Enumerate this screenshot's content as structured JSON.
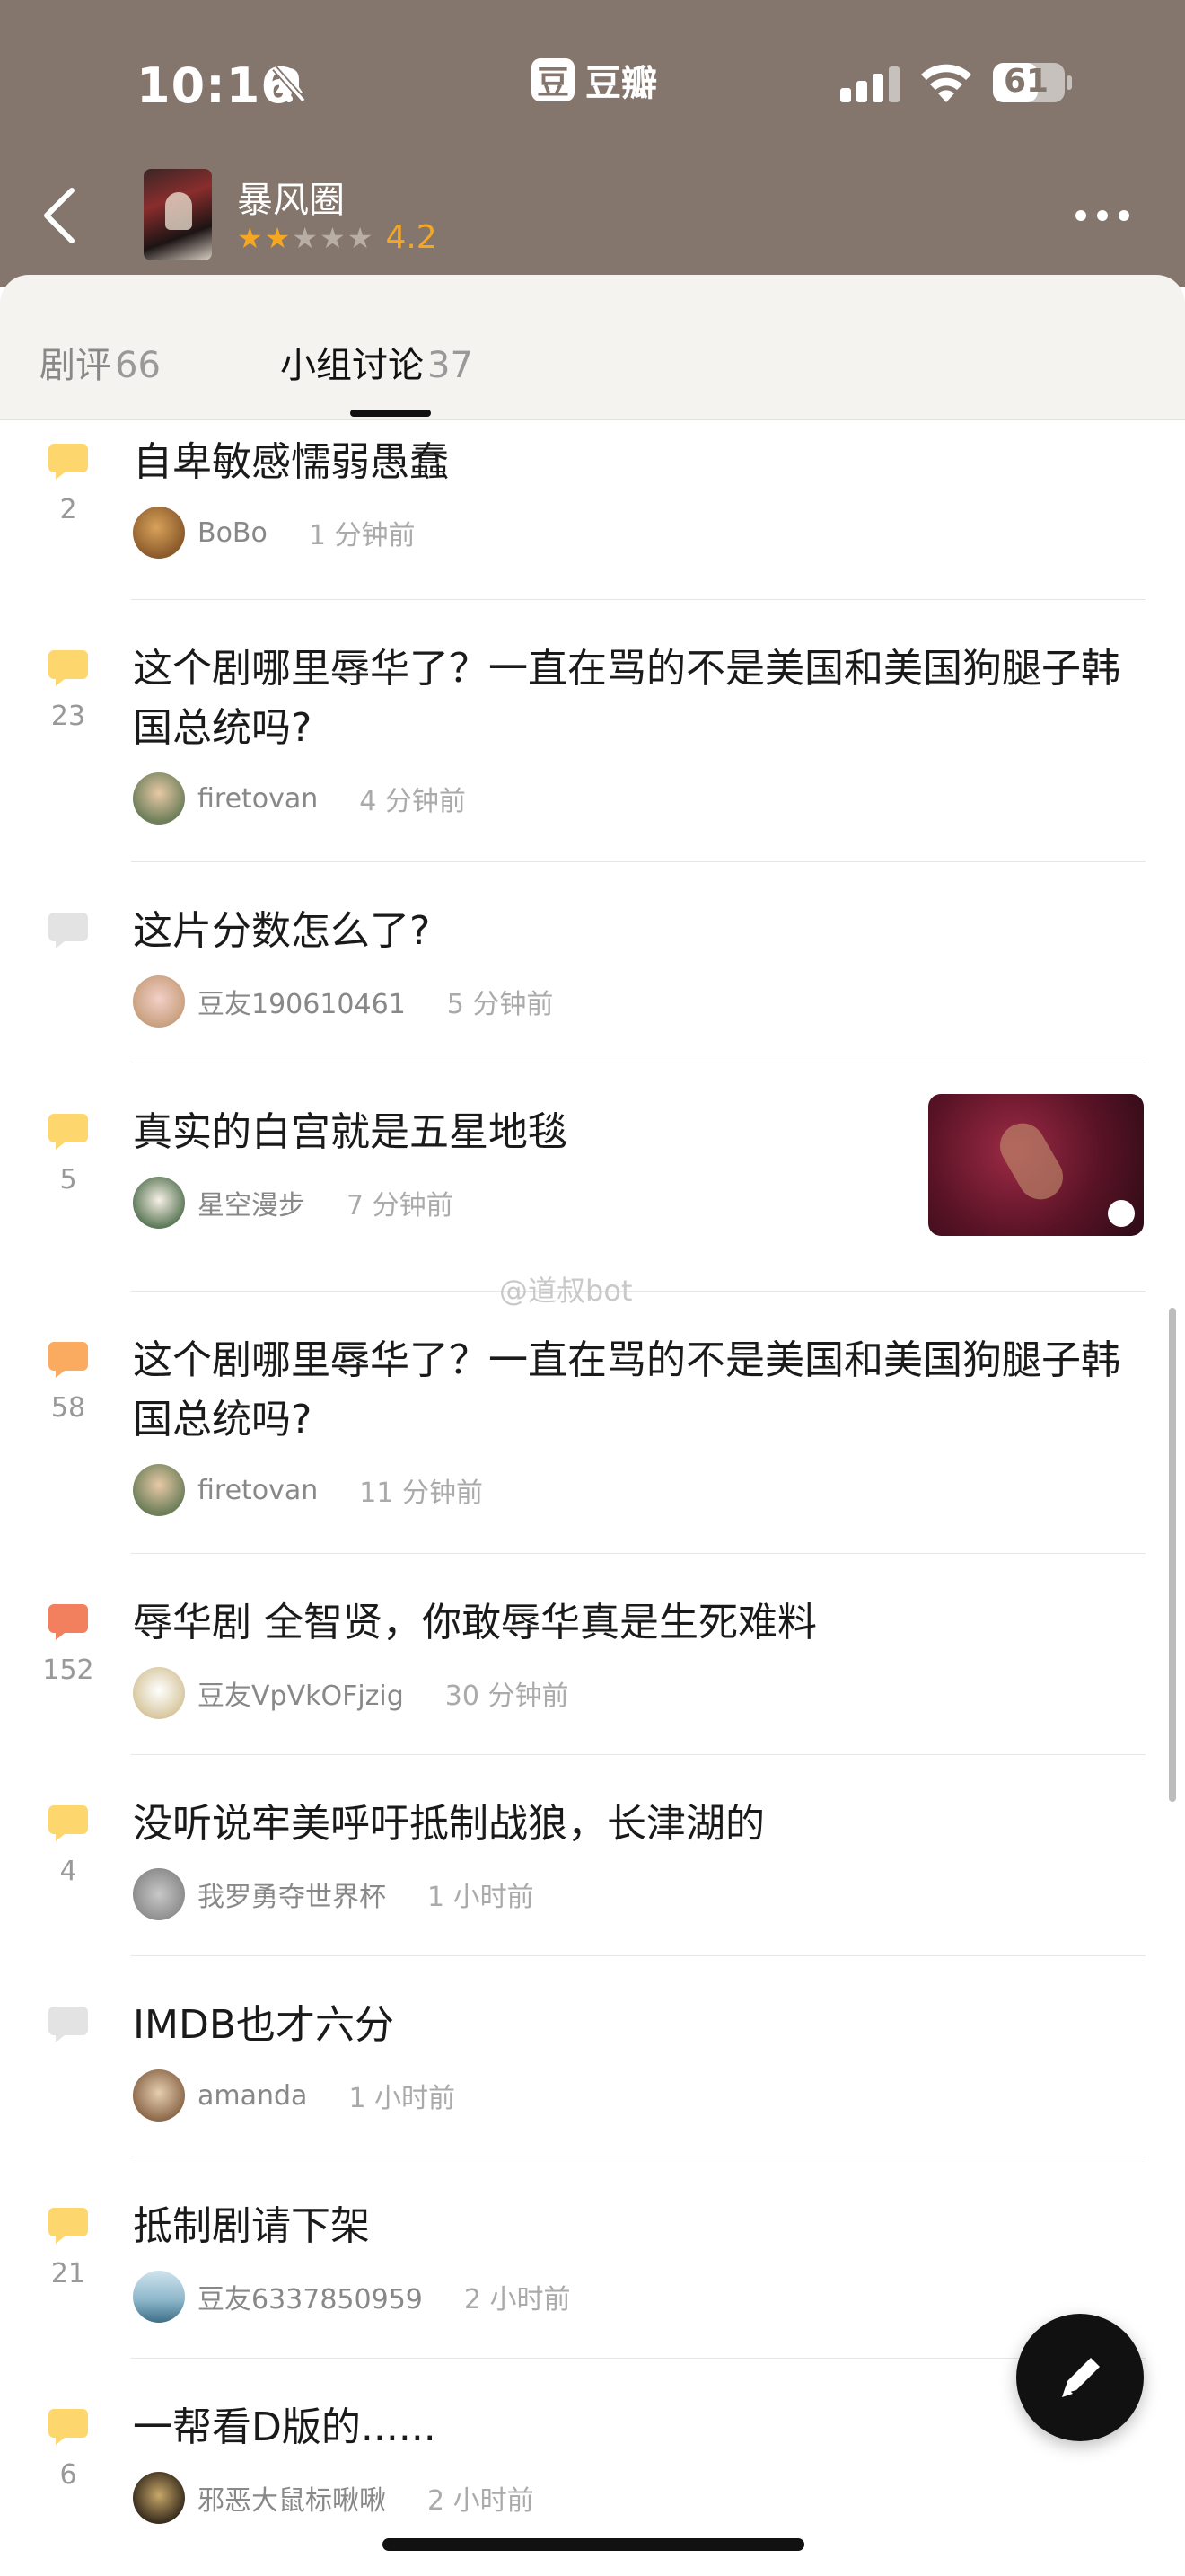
{
  "status_bar": {
    "time": "10:16",
    "app_name": "豆瓣",
    "app_logo": "豆",
    "battery": "61"
  },
  "nav": {
    "title": "暴风圈",
    "rating": "4.2",
    "stars_filled": 2,
    "stars_total": 5
  },
  "tabs": [
    {
      "label": "剧评",
      "count": "66"
    },
    {
      "label": "小组讨论",
      "count": "37"
    }
  ],
  "watermark": "@道叔bot",
  "colors": {
    "header_bg": "#84766d",
    "star": "#f5a623",
    "bubble_yellow": "#fdd76d",
    "bubble_orange": "#fbab60",
    "bubble_red": "#f2805f",
    "bubble_gray": "#e3e3e3"
  },
  "posts": [
    {
      "title": "自卑敏感懦弱愚蠢",
      "count": "2",
      "author": "BoBo",
      "time": "1 分钟前",
      "bubble": "yellow"
    },
    {
      "title": "这个剧哪里辱华了？一直在骂的不是美国和美国狗腿子韩国总统吗?",
      "count": "23",
      "author": "firetovan",
      "time": "4 分钟前",
      "bubble": "yellow"
    },
    {
      "title": "这片分数怎么了?",
      "count": "",
      "author": "豆友190610461",
      "time": "5 分钟前",
      "bubble": "gray"
    },
    {
      "title": "真实的白宫就是五星地毯",
      "count": "5",
      "author": "星空漫步",
      "time": "7 分钟前",
      "bubble": "yellow",
      "has_thumbnail": true
    },
    {
      "title": "这个剧哪里辱华了？一直在骂的不是美国和美国狗腿子韩国总统吗?",
      "count": "58",
      "author": "firetovan",
      "time": "11 分钟前",
      "bubble": "orange"
    },
    {
      "title": "辱华剧 全智贤，你敢辱华真是生死难料",
      "count": "152",
      "author": "豆友VpVkOFjzig",
      "time": "30 分钟前",
      "bubble": "red"
    },
    {
      "title": "没听说牢美呼吁抵制战狼，长津湖的",
      "count": "4",
      "author": "我罗勇夺世界杯",
      "time": "1 小时前",
      "bubble": "yellow"
    },
    {
      "title": "IMDB也才六分",
      "count": "",
      "author": "amanda",
      "time": "1 小时前",
      "bubble": "gray"
    },
    {
      "title": "抵制剧请下架",
      "count": "21",
      "author": "豆友6337850959",
      "time": "2 小时前",
      "bubble": "yellow"
    },
    {
      "title": "一帮看D版的......",
      "count": "6",
      "author": "邪恶大鼠标啾啾",
      "time": "2 小时前",
      "bubble": "yellow"
    }
  ]
}
